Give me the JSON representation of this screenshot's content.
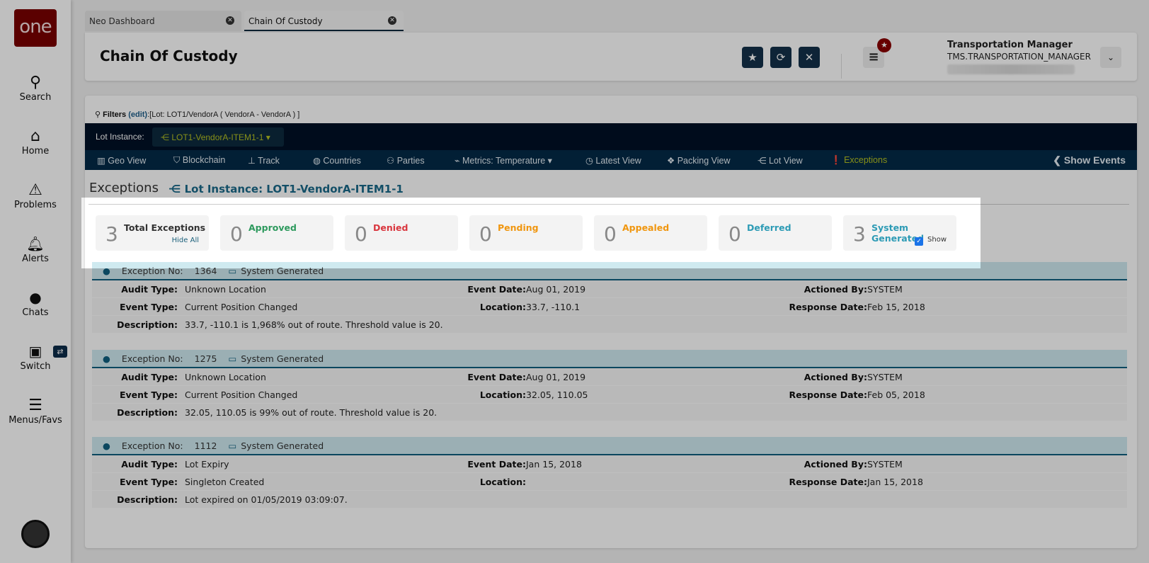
{
  "sidebar": {
    "logo": "one",
    "items": [
      {
        "label": "Search"
      },
      {
        "label": "Home"
      },
      {
        "label": "Problems"
      },
      {
        "label": "Alerts"
      },
      {
        "label": "Chats"
      },
      {
        "label": "Switch"
      },
      {
        "label": "Menus/Favs"
      }
    ],
    "switch_badge": "⇄"
  },
  "tabs": [
    {
      "label": "Neo Dashboard"
    },
    {
      "label": "Chain Of Custody"
    }
  ],
  "header": {
    "title": "Chain Of Custody",
    "user_name": "Transportation Manager",
    "user_role": "TMS.TRANSPORTATION_MANAGER"
  },
  "filters": {
    "prefix": "Filters",
    "edit": "(edit)",
    "text": ":[Lot: LOT1/VendorA ( VendorA - VendorA ) ]"
  },
  "lotbar": {
    "label": "Lot Instance:",
    "value": "LOT1-VendorA-ITEM1-1"
  },
  "nav": [
    {
      "label": "Geo View",
      "icon": "map-icon",
      "g": "▥"
    },
    {
      "label": "Blockchain",
      "icon": "shield-icon",
      "g": "⛉"
    },
    {
      "label": "Track",
      "icon": "pin-icon",
      "g": "⊥"
    },
    {
      "label": "Countries",
      "icon": "globe-icon",
      "g": "◍"
    },
    {
      "label": "Parties",
      "icon": "users-icon",
      "g": "⚇"
    },
    {
      "label": "Metrics: Temperature ▾",
      "icon": "chart-icon",
      "g": "⌁"
    },
    {
      "label": "Latest View",
      "icon": "clock-icon",
      "g": "◷"
    },
    {
      "label": "Packing View",
      "icon": "dropbox-icon",
      "g": "❖"
    },
    {
      "label": "Lot View",
      "icon": "share-icon",
      "g": "⋲"
    },
    {
      "label": "Exceptions",
      "icon": "exclamation-icon",
      "g": "❗"
    }
  ],
  "show_events": "Show Events",
  "page": {
    "heading": "Exceptions",
    "lot_link": "Lot Instance: LOT1-VendorA-ITEM1-1"
  },
  "cards": [
    {
      "count": "3",
      "label": "Total Exceptions",
      "color": "#333333",
      "sub": "Hide All"
    },
    {
      "count": "0",
      "label": "Approved",
      "color": "#2e9a5e"
    },
    {
      "count": "0",
      "label": "Denied",
      "color": "#d9363e"
    },
    {
      "count": "0",
      "label": "Pending",
      "color": "#f0960f"
    },
    {
      "count": "0",
      "label": "Appealed",
      "color": "#f0960f"
    },
    {
      "count": "0",
      "label": "Deferred",
      "color": "#2d9bb5"
    },
    {
      "count": "3",
      "label": "System Generated",
      "color": "#2d9bb5",
      "check": "Show"
    }
  ],
  "labels": {
    "exception_no": "Exception No:",
    "audit": "Audit Type:",
    "event_type": "Event Type:",
    "description": "Description:",
    "event_date": "Event Date:",
    "location": "Location:",
    "actioned": "Actioned By:",
    "response": "Response Date:"
  },
  "exceptions": [
    {
      "no": "1364",
      "source": "System Generated",
      "audit": "Unknown Location",
      "event_type": "Current Position Changed",
      "description": "33.7, -110.1 is 1,968% out of route. Threshold value is 20.",
      "event_date": "Aug 01, 2019",
      "location": "33.7, -110.1",
      "actioned": "SYSTEM",
      "response": "Feb 15, 2018"
    },
    {
      "no": "1275",
      "source": "System Generated",
      "audit": "Unknown Location",
      "event_type": "Current Position Changed",
      "description": "32.05, 110.05 is 99% out of route. Threshold value is 20.",
      "event_date": "Aug 01, 2019",
      "location": "32.05, 110.05",
      "actioned": "SYSTEM",
      "response": "Feb 05, 2018"
    },
    {
      "no": "1112",
      "source": "System Generated",
      "audit": "Lot Expiry",
      "event_type": "Singleton Created",
      "description": "Lot expired on 01/05/2019 03:09:07.",
      "event_date": "Jan 15, 2018",
      "location": "",
      "actioned": "SYSTEM",
      "response": "Jan 15, 2018"
    }
  ]
}
